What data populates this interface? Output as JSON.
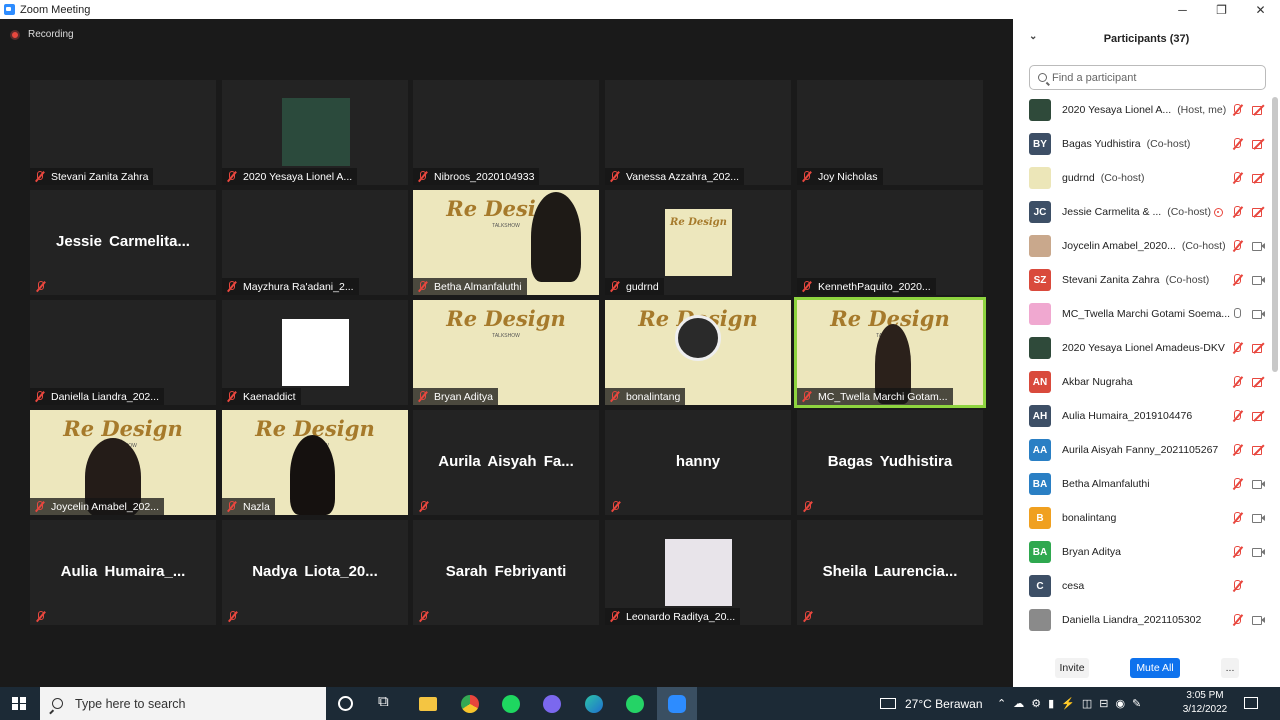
{
  "window": {
    "title": "Zoom Meeting",
    "minimize": "─",
    "maximize": "❐",
    "close": "✕"
  },
  "meeting": {
    "recording_label": "Recording",
    "tiles": [
      {
        "label": "Stevani Zanita Zahra"
      },
      {
        "label": "2020 Yesaya Lionel A..."
      },
      {
        "label": "Nibroos_2020104933"
      },
      {
        "label": "Vanessa Azzahra_202..."
      },
      {
        "label": "Joy Nicholas"
      },
      {
        "big": "Jessie  Carmelita..."
      },
      {
        "label": "Mayzhura Ra'adani_2..."
      },
      {
        "label": "Betha Almanfaluthi"
      },
      {
        "label": "gudrnd"
      },
      {
        "label": "KennethPaquito_2020..."
      },
      {
        "label": "Daniella Liandra_202..."
      },
      {
        "label": "Kaenaddict"
      },
      {
        "label": "Bryan Aditya"
      },
      {
        "label": "bonalintang"
      },
      {
        "label": "MC_Twella Marchi Gotam..."
      },
      {
        "label": "Joycelin Amabel_202..."
      },
      {
        "label": "Nazla"
      },
      {
        "big": "Aurila  Aisyah  Fa..."
      },
      {
        "big": "hanny"
      },
      {
        "big": "Bagas Yudhistira"
      },
      {
        "big": "Aulia  Humaira_..."
      },
      {
        "big": "Nadya  Liota_20..."
      },
      {
        "big": "Sarah Febriyanti"
      },
      {
        "label": "Leonardo Raditya_20..."
      },
      {
        "big": "Sheila  Laurencia..."
      }
    ],
    "redesign_text": "Re Design",
    "redesign_sub": "TALKSHOW"
  },
  "panel": {
    "title": "Participants (37)",
    "search_placeholder": "Find a participant",
    "participants": [
      {
        "name": "2020 Yesaya Lionel A...",
        "role": "(Host, me)",
        "initials": "",
        "color": "#2f4a3a",
        "mic": "off",
        "cam": "off"
      },
      {
        "name": "Bagas Yudhistira",
        "role": "(Co-host)",
        "initials": "BY",
        "color": "#3d4f66",
        "mic": "off",
        "cam": "off"
      },
      {
        "name": "gudrnd",
        "role": "(Co-host)",
        "initials": "",
        "color": "#ece6b8",
        "mic": "off",
        "cam": "off"
      },
      {
        "name": "Jessie Carmelita & ...",
        "role": "(Co-host)",
        "initials": "JC",
        "color": "#3d4f66",
        "mic": "off",
        "cam": "off",
        "share": true
      },
      {
        "name": "Joycelin Amabel_2020...",
        "role": "(Co-host)",
        "initials": "",
        "color": "#c9a88c",
        "mic": "off",
        "cam": "on"
      },
      {
        "name": "Stevani Zanita Zahra",
        "role": "(Co-host)",
        "initials": "SZ",
        "color": "#d94a3c",
        "mic": "off",
        "cam": "on"
      },
      {
        "name": "MC_Twella Marchi Gotami Soema...",
        "role": "",
        "initials": "",
        "color": "#f0a8d0",
        "mic": "on",
        "cam": "on"
      },
      {
        "name": "2020 Yesaya Lionel Amadeus-DKV",
        "role": "",
        "initials": "",
        "color": "#2f4a3a",
        "mic": "off",
        "cam": "off"
      },
      {
        "name": "Akbar Nugraha",
        "role": "",
        "initials": "AN",
        "color": "#d94a3c",
        "mic": "off",
        "cam": "off"
      },
      {
        "name": "Aulia Humaira_2019104476",
        "role": "",
        "initials": "AH",
        "color": "#3d4f66",
        "mic": "off",
        "cam": "off"
      },
      {
        "name": "Aurila Aisyah Fanny_2021105267",
        "role": "",
        "initials": "AA",
        "color": "#2a7fc4",
        "mic": "off",
        "cam": "off"
      },
      {
        "name": "Betha Almanfaluthi",
        "role": "",
        "initials": "BA",
        "color": "#2a7fc4",
        "mic": "off",
        "cam": "on"
      },
      {
        "name": "bonalintang",
        "role": "",
        "initials": "B",
        "color": "#f0a020",
        "mic": "off",
        "cam": "on"
      },
      {
        "name": "Bryan Aditya",
        "role": "",
        "initials": "BA",
        "color": "#2fa84f",
        "mic": "off",
        "cam": "on"
      },
      {
        "name": "cesa",
        "role": "",
        "initials": "C",
        "color": "#3d4f66",
        "mic": "off",
        "cam": "none"
      },
      {
        "name": "Daniella Liandra_2021105302",
        "role": "",
        "initials": "",
        "color": "#8a8a8a",
        "mic": "off",
        "cam": "on"
      }
    ],
    "invite_label": "Invite",
    "mute_all_label": "Mute All",
    "more_label": "..."
  },
  "taskbar": {
    "search_text": "Type here to search",
    "weather": "27°C  Berawan",
    "time": "3:05 PM",
    "date": "3/12/2022"
  }
}
